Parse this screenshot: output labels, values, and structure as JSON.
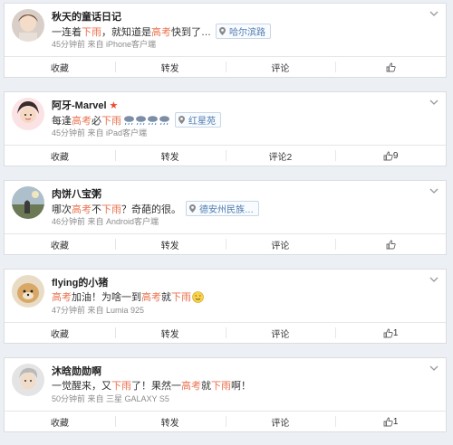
{
  "posts": [
    {
      "name": "秋天的童话日记",
      "vip": "",
      "text_parts": [
        "一连着",
        "下雨",
        "，就知道是",
        "高考",
        "快到了…"
      ],
      "location": "哈尔滨路",
      "time": "45分钟前",
      "source": "来自 iPhone客户端",
      "actions": {
        "fav": "收藏",
        "repost": "转发",
        "comment": "评论",
        "like": ""
      }
    },
    {
      "name": "阿牙-Marvel",
      "vip": "★",
      "text_parts": [
        "每逢",
        "高考",
        " 必",
        "下雨",
        ""
      ],
      "location": "红星苑",
      "time": "45分钟前",
      "source": "来自 iPad客户端",
      "actions": {
        "fav": "收藏",
        "repost": "转发",
        "comment": "评论2",
        "like": "9"
      }
    },
    {
      "name": "肉饼八宝粥",
      "vip": "",
      "text_parts": [
        "哪次",
        "高考",
        "不",
        "下雨",
        "？奇葩的很。"
      ],
      "location": "德安州民族…",
      "time": "46分钟前",
      "source": "来自 Android客户端",
      "actions": {
        "fav": "收藏",
        "repost": "转发",
        "comment": "评论",
        "like": ""
      }
    },
    {
      "name": "flying的小猪",
      "vip": "",
      "text_parts": [
        "高考",
        "加油！为啥一到",
        "高考",
        "就",
        "下雨"
      ],
      "location": "",
      "time": "47分钟前",
      "source": "来自 Lumia 925",
      "actions": {
        "fav": "收藏",
        "repost": "转发",
        "comment": "评论",
        "like": "1"
      }
    },
    {
      "name": "沐晗勋勋啊",
      "vip": "",
      "text_parts": [
        "一觉醒来，又",
        "下雨",
        "了！果然一",
        "高考",
        "就",
        "下雨",
        "啊！"
      ],
      "location": "",
      "time": "50分钟前",
      "source": "来自 三星 GALAXY S5",
      "actions": {
        "fav": "收藏",
        "repost": "转发",
        "comment": "评论",
        "like": "1"
      }
    }
  ],
  "icons": {
    "location": "location-pin-icon",
    "like": "thumbs-up-icon",
    "more": "chevron-down-icon",
    "rain": "rain-cloud-icon",
    "smiley": "smiley-emoji-icon"
  },
  "colors": {
    "highlight": "#eb7350",
    "link": "#507daf",
    "vip": "#f0482a"
  }
}
